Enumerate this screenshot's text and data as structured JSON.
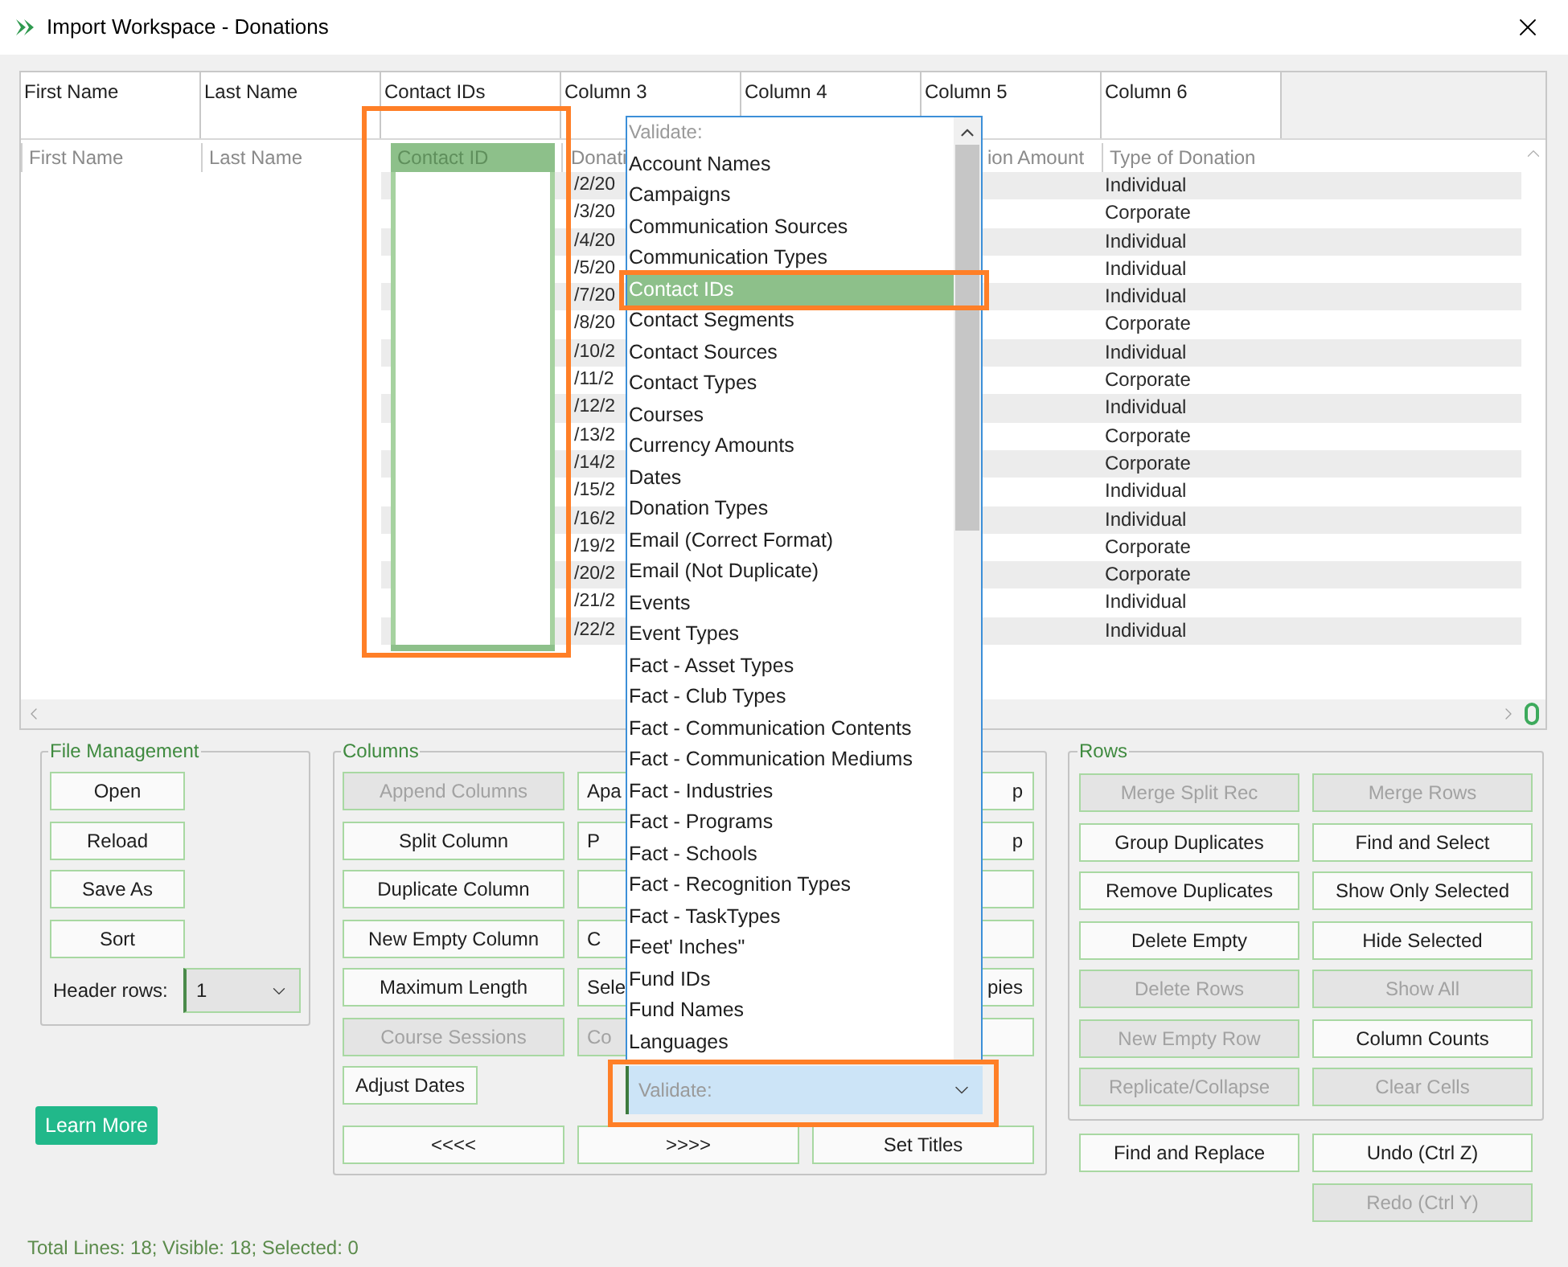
{
  "window": {
    "title": "Import Workspace - Donations"
  },
  "table": {
    "columns": [
      {
        "title": "First Name",
        "field": "First Name",
        "selected": false
      },
      {
        "title": "Last Name",
        "field": "Last Name",
        "selected": false
      },
      {
        "title": "Contact IDs",
        "field": "Contact ID",
        "selected": true
      },
      {
        "title": "Column 3",
        "field": "Donati",
        "selected": false
      },
      {
        "title": "Column 4",
        "selected": false
      },
      {
        "title": "Column 5",
        "field": "ion Amount",
        "selected": false
      },
      {
        "title": "Column 6",
        "field": "Type of Donation",
        "selected": false
      }
    ],
    "rows": [
      {
        "column_4": "/2/20",
        "column_7": "Individual"
      },
      {
        "column_4": "/3/20",
        "column_7": "Corporate"
      },
      {
        "column_4": "/4/20",
        "column_7": "Individual"
      },
      {
        "column_4": "/5/20",
        "column_7": "Individual"
      },
      {
        "column_4": "/7/20",
        "column_7": "Individual"
      },
      {
        "column_4": "/8/20",
        "column_7": "Corporate"
      },
      {
        "column_4": "/10/2",
        "column_7": "Individual"
      },
      {
        "column_4": "/11/2",
        "column_7": "Corporate"
      },
      {
        "column_4": "/12/2",
        "column_7": "Individual"
      },
      {
        "column_4": "/13/2",
        "column_7": "Corporate"
      },
      {
        "column_4": "/14/2",
        "column_7": "Corporate"
      },
      {
        "column_4": "/15/2",
        "column_7": "Individual"
      },
      {
        "column_4": "/16/2",
        "column_7": "Individual"
      },
      {
        "column_4": "/19/2",
        "column_7": "Corporate"
      },
      {
        "column_4": "/20/2",
        "column_7": "Corporate"
      },
      {
        "column_4": "/21/2",
        "column_7": "Individual"
      },
      {
        "column_4": "/22/2",
        "column_7": "Individual"
      }
    ]
  },
  "file_management": {
    "title": "File Management",
    "buttons": [
      {
        "label": "Open",
        "disabled": false
      },
      {
        "label": "Reload",
        "disabled": false
      },
      {
        "label": "Save As",
        "disabled": false
      },
      {
        "label": "Sort",
        "disabled": false
      }
    ],
    "header_rows": {
      "label": "Header rows:",
      "value": "1"
    }
  },
  "learn_more": "Learn More",
  "columns_group": {
    "title": "Columns",
    "button_rows": [
      [
        {
          "label": "Append Columns",
          "disabled": true
        },
        {
          "label": "Apa",
          "disabled": false
        },
        {
          "label": "p",
          "disabled": false
        }
      ],
      [
        {
          "label": "Split Column",
          "disabled": false
        },
        {
          "label": "P",
          "disabled": false
        },
        {
          "label": "p",
          "disabled": false
        }
      ],
      [
        {
          "label": "Duplicate Column",
          "disabled": false
        },
        {
          "disabled": false
        },
        {
          "disabled": false
        }
      ],
      [
        {
          "label": "New Empty Column",
          "disabled": false
        },
        {
          "label": "C",
          "disabled": false
        },
        {
          "disabled": false
        }
      ],
      [
        {
          "label": "Maximum Length",
          "disabled": false
        },
        {
          "label": "Sele",
          "disabled": false
        },
        {
          "label": "pies",
          "disabled": false
        }
      ],
      [
        {
          "label": "Course Sessions",
          "disabled": true
        },
        {
          "label": "Co",
          "disabled": true
        },
        {
          "disabled": false
        }
      ]
    ],
    "adjust_dates": {
      "label": "Adjust Dates",
      "disabled": false
    },
    "validate": {
      "placeholder": "Validate:",
      "expanded": true
    },
    "bottom_buttons": [
      {
        "label": "<<<<",
        "disabled": false
      },
      {
        "label": ">>>>",
        "disabled": false
      },
      {
        "label": "Set Titles",
        "disabled": false
      }
    ]
  },
  "validate_list": {
    "header": "Validate:",
    "options": [
      {
        "label": "Account Names",
        "selected": false
      },
      {
        "label": "Campaigns",
        "selected": false
      },
      {
        "label": "Communication Sources",
        "selected": false
      },
      {
        "label": "Communication Types",
        "selected": false
      },
      {
        "label": "Contact IDs",
        "selected": true
      },
      {
        "label": "Contact Segments",
        "selected": false
      },
      {
        "label": "Contact Sources",
        "selected": false
      },
      {
        "label": "Contact Types",
        "selected": false
      },
      {
        "label": "Courses",
        "selected": false
      },
      {
        "label": "Currency Amounts",
        "selected": false
      },
      {
        "label": "Dates",
        "selected": false
      },
      {
        "label": "Donation Types",
        "selected": false
      },
      {
        "label": "Email (Correct Format)",
        "selected": false
      },
      {
        "label": "Email (Not Duplicate)",
        "selected": false
      },
      {
        "label": "Events",
        "selected": false
      },
      {
        "label": "Event Types",
        "selected": false
      },
      {
        "label": "Fact - Asset Types",
        "selected": false
      },
      {
        "label": "Fact - Club Types",
        "selected": false
      },
      {
        "label": "Fact - Communication Contents",
        "selected": false
      },
      {
        "label": "Fact - Communication Mediums",
        "selected": false
      },
      {
        "label": "Fact - Industries",
        "selected": false
      },
      {
        "label": "Fact - Programs",
        "selected": false
      },
      {
        "label": "Fact - Schools",
        "selected": false
      },
      {
        "label": "Fact - Recognition Types",
        "selected": false
      },
      {
        "label": "Fact - TaskTypes",
        "selected": false
      },
      {
        "label": "Feet' Inches\"",
        "selected": false
      },
      {
        "label": "Fund IDs",
        "selected": false
      },
      {
        "label": "Fund Names",
        "selected": false
      },
      {
        "label": "Languages",
        "selected": false
      }
    ]
  },
  "rows_group": {
    "title": "Rows",
    "buttons": [
      {
        "label": "Merge Split Rec",
        "disabled": true
      },
      {
        "label": "Merge Rows",
        "disabled": true
      },
      {
        "label": "Group Duplicates",
        "disabled": false
      },
      {
        "label": "Find and Select",
        "disabled": false
      },
      {
        "label": "Remove Duplicates",
        "disabled": false
      },
      {
        "label": "Show Only Selected",
        "disabled": false
      },
      {
        "label": "Delete Empty",
        "disabled": false
      },
      {
        "label": "Hide Selected",
        "disabled": false
      },
      {
        "label": "Delete Rows",
        "disabled": true
      },
      {
        "label": "Show All",
        "disabled": true
      },
      {
        "label": "New Empty Row",
        "disabled": true
      },
      {
        "label": "Column Counts",
        "disabled": false
      },
      {
        "label": "Replicate/Collapse",
        "disabled": true
      },
      {
        "label": "Clear Cells",
        "disabled": true
      }
    ]
  },
  "edit_buttons": [
    {
      "label": "Find and Replace",
      "disabled": false
    },
    {
      "label": "Undo (Ctrl Z)",
      "disabled": false
    },
    {
      "label": "Redo (Ctrl Y)",
      "disabled": true
    }
  ],
  "status_bar": "Total Lines: 18; Visible: 18; Selected: 0"
}
